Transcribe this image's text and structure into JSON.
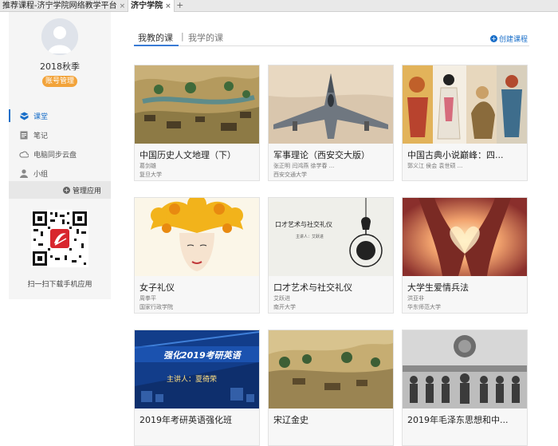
{
  "tabbar": {
    "tabs": [
      {
        "label": "推荐课程-济宁学院网络教学平台",
        "active": false
      },
      {
        "label": "济宁学院",
        "active": true
      }
    ],
    "close_glyph": "×",
    "add_glyph": "+"
  },
  "sidebar": {
    "term": "2018秋季",
    "account_button": "账号管理",
    "nav": [
      {
        "label": "课堂",
        "icon": "cube-icon",
        "active": true
      },
      {
        "label": "笔记",
        "icon": "note-icon",
        "active": false
      },
      {
        "label": "电脑同步云盘",
        "icon": "cloud-icon",
        "active": false
      },
      {
        "label": "小组",
        "icon": "user-icon",
        "active": false
      }
    ],
    "manage_apps": "管理应用",
    "qr_caption": "扫一扫下载手机应用"
  },
  "main": {
    "tab_teaching": "我教的课",
    "tab_separator": "|",
    "tab_learning": "我学的课",
    "create_course": "创建课程",
    "courses": [
      {
        "title": "中国历史人文地理（下）",
        "teacher": "葛剑雄",
        "school": "复旦大学"
      },
      {
        "title": "军事理论（西安交大版）",
        "teacher": "张正明 闫鸿燕 徐学春 ...",
        "school": "西安交通大学"
      },
      {
        "title": "中国古典小说巅峰：四...",
        "teacher": "郭义江 侯会 袁世硕 ...",
        "school": ""
      },
      {
        "title": "女子礼仪",
        "teacher": "周拳平",
        "school": "国家行政学院"
      },
      {
        "title": "口才艺术与社交礼仪",
        "teacher": "艾跃进",
        "school": "南开大学"
      },
      {
        "title": "大学生爱情兵法",
        "teacher": "洪亚非",
        "school": "华东师范大学"
      },
      {
        "title": "2019年考研英语强化班",
        "teacher": "",
        "school": ""
      },
      {
        "title": "宋辽金史",
        "teacher": "",
        "school": ""
      },
      {
        "title": "2019年毛泽东思想和中...",
        "teacher": "",
        "school": ""
      }
    ],
    "card_images": {
      "english_banner_title": "强化2019考研英语",
      "english_banner_speaker": "主讲人：夏徛荣",
      "eloquence_image_title": "口才艺术与社交礼仪",
      "eloquence_image_speaker": "主讲人：艾跃进"
    }
  },
  "colors": {
    "accent": "#1a6fc9",
    "account_button": "#f2a33a",
    "sidebar_bg": "#f5f5f5"
  }
}
